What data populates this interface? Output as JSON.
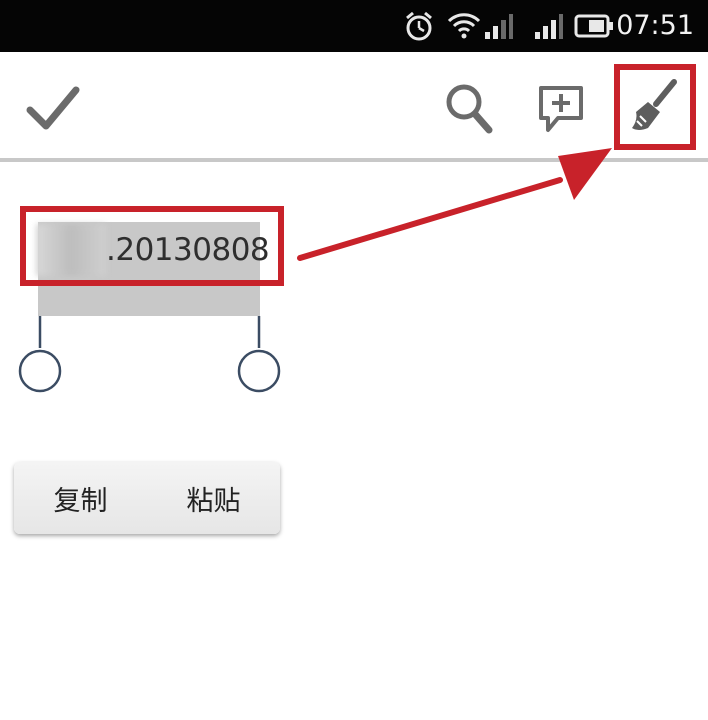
{
  "status_bar": {
    "time": "07:51",
    "icons": [
      "alarm-icon",
      "wifi-icon",
      "signal-icon",
      "signal-icon",
      "battery-icon"
    ]
  },
  "action_bar": {
    "icons": [
      "check-icon",
      "search-icon",
      "add-comment-icon",
      "brush-icon"
    ]
  },
  "note": {
    "selected_text": ".20130808"
  },
  "context_menu": {
    "copy": "复制",
    "paste": "粘贴"
  },
  "colors": {
    "annotation": "#c8222a",
    "selection": "#c8c8c8",
    "handle": "#3b4c63",
    "status_bar": "#050505"
  }
}
